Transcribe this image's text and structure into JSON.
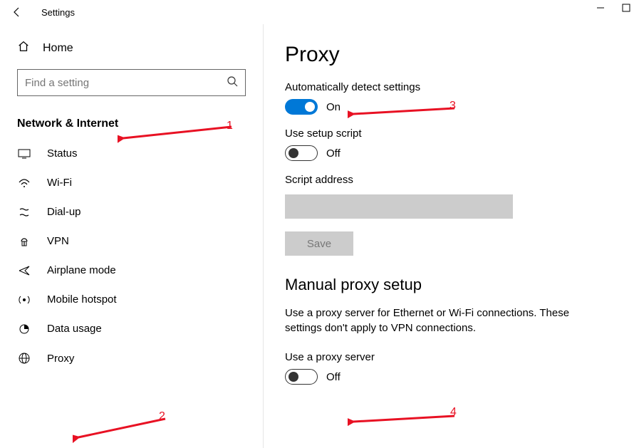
{
  "window": {
    "title": "Settings"
  },
  "sidebar": {
    "home_label": "Home",
    "search_placeholder": "Find a setting",
    "category": "Network & Internet",
    "items": [
      {
        "label": "Status"
      },
      {
        "label": "Wi-Fi"
      },
      {
        "label": "Dial-up"
      },
      {
        "label": "VPN"
      },
      {
        "label": "Airplane mode"
      },
      {
        "label": "Mobile hotspot"
      },
      {
        "label": "Data usage"
      },
      {
        "label": "Proxy"
      }
    ]
  },
  "main": {
    "title": "Proxy",
    "auto_detect": {
      "label": "Automatically detect settings",
      "state": "On"
    },
    "setup_script": {
      "label": "Use setup script",
      "state": "Off"
    },
    "script_address_label": "Script address",
    "save_label": "Save",
    "manual_heading": "Manual proxy setup",
    "manual_desc": "Use a proxy server for Ethernet or Wi-Fi connections. These settings don't apply to VPN connections.",
    "use_proxy": {
      "label": "Use a proxy server",
      "state": "Off"
    }
  },
  "annotations": {
    "n1": "1",
    "n2": "2",
    "n3": "3",
    "n4": "4"
  }
}
